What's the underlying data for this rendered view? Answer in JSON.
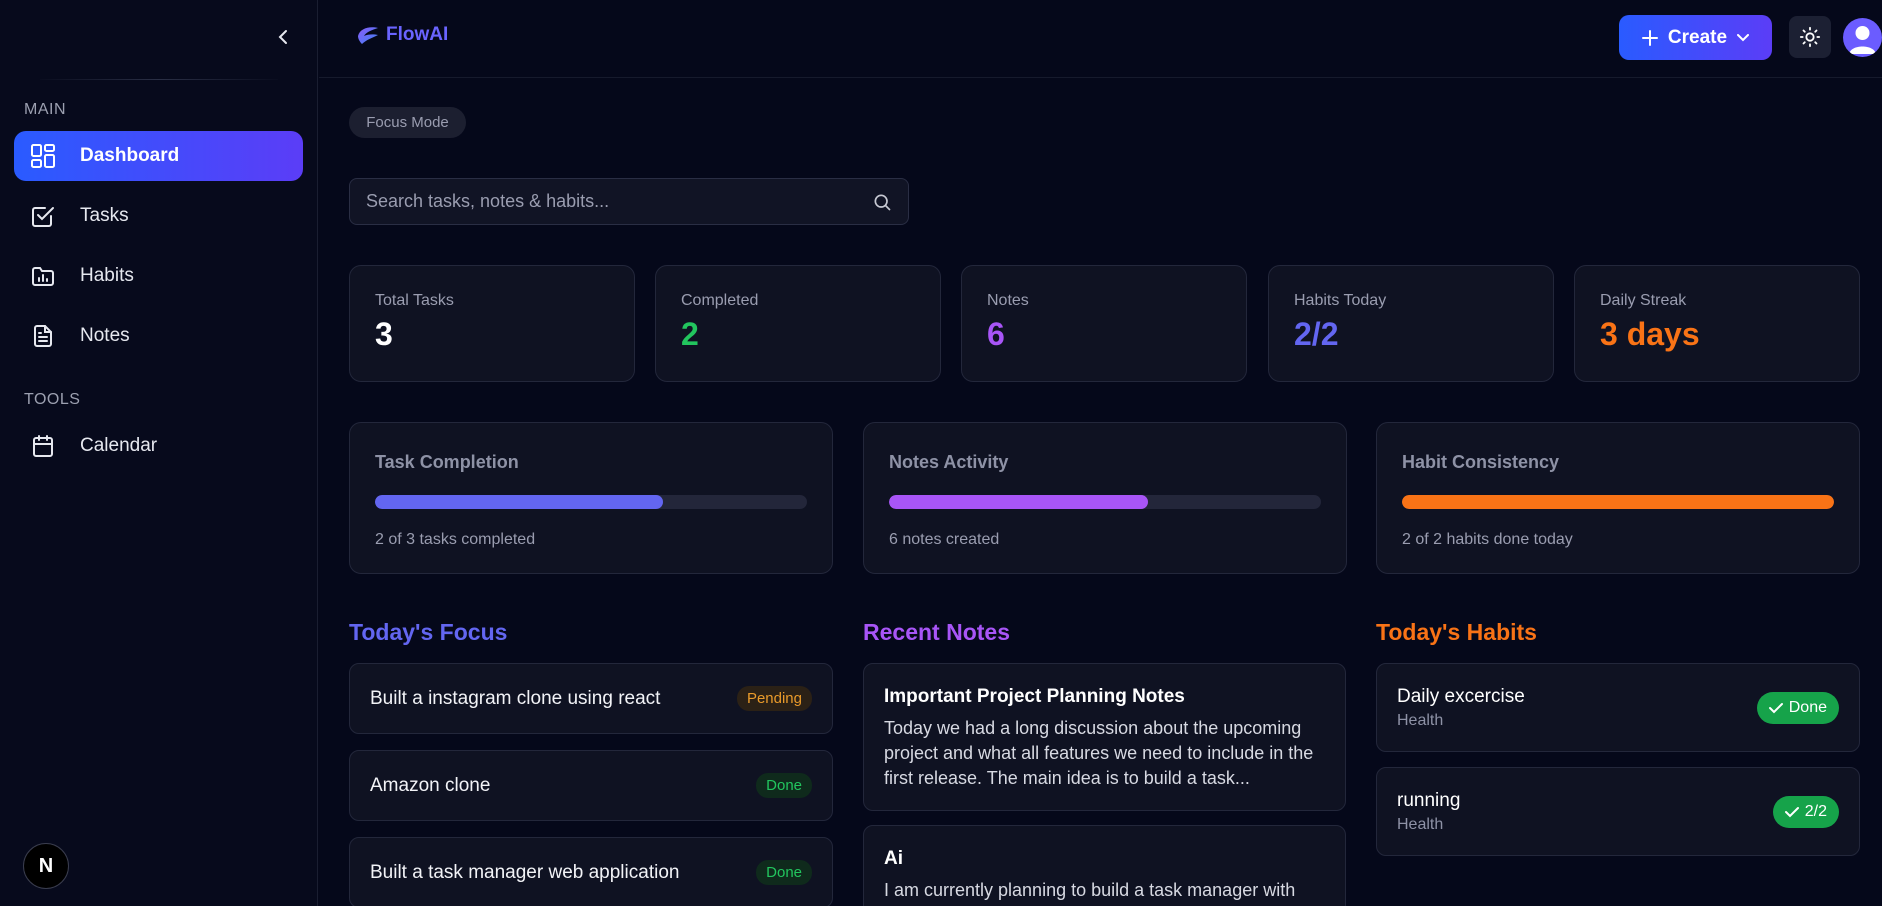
{
  "sidebar": {
    "sections": {
      "main": "MAIN",
      "tools": "TOOLS"
    },
    "items": [
      {
        "label": "Dashboard",
        "icon": "dashboard-icon"
      },
      {
        "label": "Tasks",
        "icon": "check-square-icon"
      },
      {
        "label": "Habits",
        "icon": "folder-chart-icon"
      },
      {
        "label": "Notes",
        "icon": "file-text-icon"
      },
      {
        "label": "Calendar",
        "icon": "calendar-icon"
      }
    ],
    "badge": "N"
  },
  "header": {
    "logo_text": "FlowAI",
    "create_label": "Create"
  },
  "main": {
    "focus_mode": "Focus Mode",
    "search_placeholder": "Search tasks, notes & habits...",
    "stats": [
      {
        "label": "Total Tasks",
        "value": "3",
        "color": "#ffffff"
      },
      {
        "label": "Completed",
        "value": "2",
        "color": "#22c55e"
      },
      {
        "label": "Notes",
        "value": "6",
        "color": "#a855f7"
      },
      {
        "label": "Habits Today",
        "value": "2/2",
        "color": "#6366f1"
      },
      {
        "label": "Daily Streak",
        "value": "3 days",
        "color": "#f97316"
      }
    ],
    "progress": [
      {
        "title": "Task Completion",
        "subtitle": "2 of 3 tasks completed",
        "fraction": 0.667,
        "color": "#6366f1"
      },
      {
        "title": "Notes Activity",
        "subtitle": "6 notes created",
        "fraction": 0.6,
        "color": "#a855f7"
      },
      {
        "title": "Habit Consistency",
        "subtitle": "2 of 2 habits done today",
        "fraction": 1.0,
        "color": "#f97316"
      }
    ],
    "focus": {
      "title": "Today's Focus",
      "color": "#6366f1",
      "tasks": [
        {
          "title": "Built a instagram clone using react",
          "status": "Pending"
        },
        {
          "title": "Amazon clone",
          "status": "Done"
        },
        {
          "title": "Built a task manager web application",
          "status": "Done"
        }
      ]
    },
    "notes": {
      "title": "Recent Notes",
      "color": "#a855f7",
      "items": [
        {
          "title": "Important Project Planning Notes",
          "body": "Today we had a long discussion about the upcoming project and what all features we need to include in the first release. The main idea is to build a task..."
        },
        {
          "title": "Ai",
          "body": "I am currently planning to build a task manager with"
        }
      ]
    },
    "habits": {
      "title": "Today's Habits",
      "color": "#f97316",
      "items": [
        {
          "name": "Daily excercise",
          "category": "Health",
          "status": "Done"
        },
        {
          "name": "running",
          "category": "Health",
          "status": "2/2"
        }
      ]
    }
  }
}
